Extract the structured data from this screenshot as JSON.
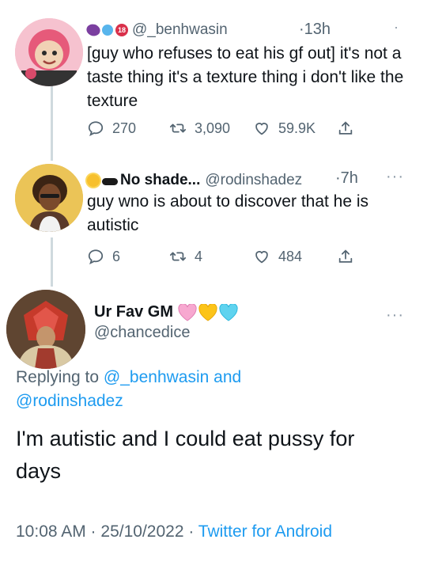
{
  "tweets": [
    {
      "display_name": "",
      "handle": "@_benhwasin",
      "time": "13h",
      "text": "[guy who refuses to eat his gf out] it's not a taste thing it's a texture thing i don't like the texture",
      "replies": "270",
      "retweets": "3,090",
      "likes": "59.9K"
    },
    {
      "display_name": "No shade...",
      "handle": "@rodinshadez",
      "time": "7h",
      "text": "guy wno is about to discover that he is autistic",
      "replies": "6",
      "retweets": "4",
      "likes": "484"
    }
  ],
  "main_tweet": {
    "display_name": "Ur Fav GM",
    "handle": "@chancedice",
    "replying_prefix": "Replying to ",
    "replying_user1": "@_benhwasin and",
    "replying_user2": "@rodinshadez",
    "text": "I'm autistic and I could eat pussy for days",
    "timestamp": "10:08 AM · 25/10/2022 · ",
    "source": "Twitter for Android"
  },
  "colors": {
    "accent": "#1d9bf0",
    "secondary_text": "#536471",
    "thread_line": "#cfd9de"
  },
  "icons": [
    "reply-icon",
    "retweet-icon",
    "like-icon",
    "share-icon",
    "more-icon"
  ]
}
